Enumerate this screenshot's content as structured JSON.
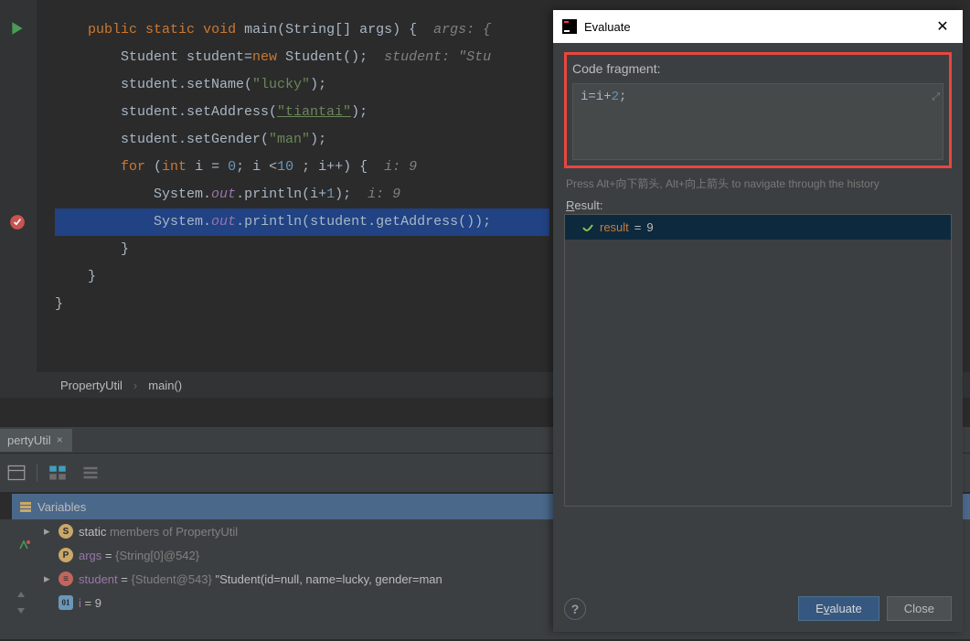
{
  "code": {
    "l1_public": "public",
    "l1_static": "static",
    "l1_void": "void",
    "l1_main": "main",
    "l1_rest": "(String[] args) {",
    "l1_hint": "  args: {",
    "l2_a": "Student student=",
    "l2_new": "new",
    "l2_b": " Student();",
    "l2_hint": "  student: \"Stu",
    "l3_a": "student.setName(",
    "l3_s": "\"lucky\"",
    "l3_b": ");",
    "l4_a": "student.setAddress(",
    "l4_s": "\"tiantai\"",
    "l4_b": ");",
    "l5_a": "student.setGender(",
    "l5_s": "\"man\"",
    "l5_b": ");",
    "l6_for": "for",
    "l6_a": " (",
    "l6_int": "int",
    "l6_b": " i = ",
    "l6_z": "0",
    "l6_c": "; i <",
    "l6_ten": "10",
    "l6_d": " ; i++) {",
    "l6_hint": "  i: 9",
    "l7_a": "System.",
    "l7_out": "out",
    "l7_b": ".println(i+",
    "l7_one": "1",
    "l7_c": ");",
    "l7_hint": "  i: 9",
    "l8_a": "System.",
    "l8_out": "out",
    "l8_b": ".println(student.getAddress());",
    "l9": "}",
    "l10": "}",
    "l11": "}"
  },
  "breadcrumb": {
    "a": "PropertyUtil",
    "b": "main()"
  },
  "tab": {
    "label": "pertyUtil"
  },
  "vars": {
    "header": "Variables",
    "static_label": "static",
    "static_rest": " members of PropertyUtil",
    "args_name": "args",
    "args_eq": " = ",
    "args_val": "{String[0]@542}",
    "student_name": "student",
    "student_eq": " = ",
    "student_val": "{Student@543}",
    "student_str": " \"Student(id=null, name=lucky, gender=man",
    "i_name": "i",
    "i_eq": " = ",
    "i_val": "9"
  },
  "dialog": {
    "title": "Evaluate",
    "fragment_label": "Code fragment:",
    "fragment_pre": "i=i+",
    "fragment_num": "2",
    "fragment_post": ";",
    "hint": "Press Alt+向下箭头, Alt+向上箭头 to navigate through the history",
    "result_label_u": "R",
    "result_label_rest": "esult:",
    "result_name": "result",
    "result_eq": " = ",
    "result_val": "9",
    "help": "?",
    "evaluate_u": "v",
    "evaluate_pre": "E",
    "evaluate_post": "aluate",
    "close": "Close"
  }
}
